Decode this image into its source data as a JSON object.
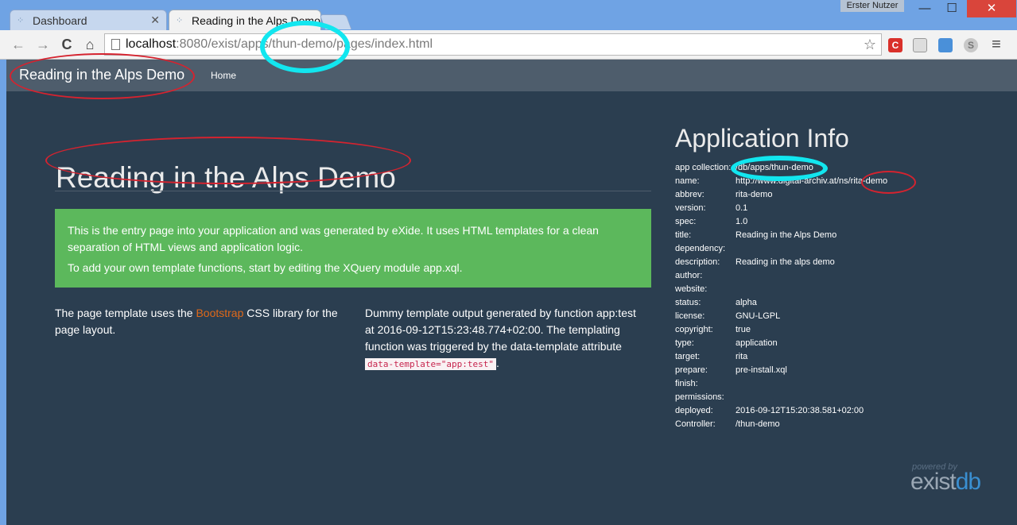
{
  "window": {
    "user": "Erster Nutzer",
    "minimize_glyph": "—",
    "maximize_glyph": "☐",
    "close_glyph": "✕"
  },
  "tabs": [
    {
      "label": "Dashboard",
      "icon": "exist-icon",
      "active": false
    },
    {
      "label": "Reading in the Alps Demo",
      "icon": "exist-icon",
      "active": true
    }
  ],
  "toolbar": {
    "url_host": "localhost",
    "url_path": ":8080/exist/apps/thun-demo/pages/index.html",
    "back_glyph": "←",
    "forward_glyph": "→",
    "reload_glyph": "C",
    "home_glyph": "⌂",
    "star_glyph": "☆",
    "menu_glyph": "≡"
  },
  "navbar": {
    "brand": "Reading in the Alps Demo",
    "home": "Home"
  },
  "main": {
    "title": "Reading in the Alps Demo",
    "alert_line1": "This is the entry page into your application and was generated by eXide. It uses HTML templates for a clean separation of HTML views and application logic.",
    "alert_line2": "To add your own template functions, start by editing the XQuery module app.xql.",
    "left_before": "The page template uses the ",
    "left_link": "Bootstrap",
    "left_after": " CSS library for the page layout.",
    "right_text": "Dummy template output generated by function app:test at 2016-09-12T15:23:48.774+02:00. The templating function was triggered by the data-template attribute ",
    "right_code": "data-template=\"app:test\"",
    "right_end": "."
  },
  "info": {
    "title": "Application Info",
    "rows": [
      {
        "key": "app collection:",
        "value": "/db/apps/thun-demo"
      },
      {
        "key": "name:",
        "value": "http://www.digital-archiv.at/ns/rita-demo"
      },
      {
        "key": "abbrev:",
        "value": "rita-demo"
      },
      {
        "key": "version:",
        "value": "0.1"
      },
      {
        "key": "spec:",
        "value": "1.0"
      },
      {
        "key": "title:",
        "value": "Reading in the Alps Demo"
      },
      {
        "key": "dependency:",
        "value": ""
      },
      {
        "key": "description:",
        "value": "Reading in the alps demo"
      },
      {
        "key": "author:",
        "value": ""
      },
      {
        "key": "website:",
        "value": ""
      },
      {
        "key": "status:",
        "value": "alpha"
      },
      {
        "key": "license:",
        "value": "GNU-LGPL"
      },
      {
        "key": "copyright:",
        "value": "true"
      },
      {
        "key": "type:",
        "value": "application"
      },
      {
        "key": "target:",
        "value": "rita"
      },
      {
        "key": "prepare:",
        "value": "pre-install.xql"
      },
      {
        "key": "finish:",
        "value": ""
      },
      {
        "key": "permissions:",
        "value": ""
      },
      {
        "key": "deployed:",
        "value": "2016-09-12T15:20:38.581+02:00"
      },
      {
        "key": "Controller:",
        "value": "/thun-demo"
      }
    ]
  },
  "footer": {
    "powered_by": "powered by",
    "logo_ex": "e",
    "logo_mid": "xist",
    "logo_db": "db"
  },
  "colors": {
    "page_bg": "#2b3e50",
    "navbar_bg": "#4e5d6c",
    "alert_bg": "#5cb85c",
    "link": "#df691a",
    "annotation_red": "#d5232f",
    "annotation_cyan": "#12e6ef"
  }
}
